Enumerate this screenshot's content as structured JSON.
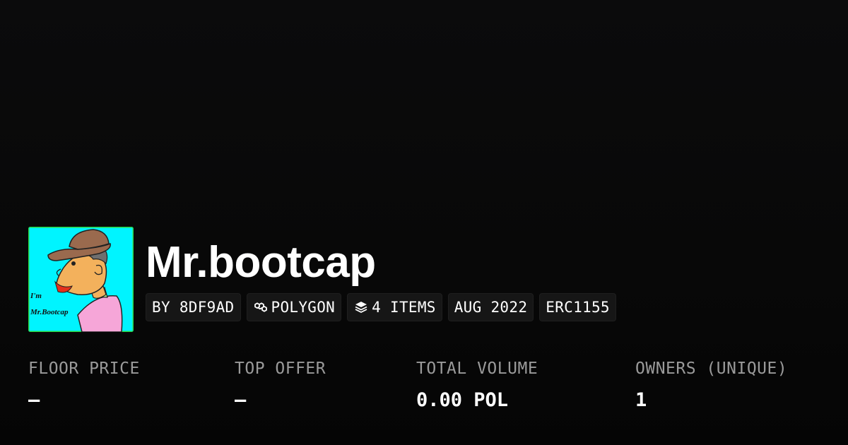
{
  "collection": {
    "name": "Mr.bootcap",
    "avatar": {
      "icon": "collection-avatar",
      "label_line1": "I'm",
      "label_line2": "Mr.Bootcap",
      "colors": {
        "background": "#00f4ff",
        "border": "#2bd63f",
        "hat": "#9a6a4e",
        "shirt": "#f6a6d8",
        "skin": "#f3b15c",
        "lips": "#e4301c"
      }
    }
  },
  "tags": [
    {
      "label": "BY 8DF9AD",
      "icon": ""
    },
    {
      "label": "POLYGON",
      "icon": "polygon-chain-icon"
    },
    {
      "label": "4 ITEMS",
      "icon": "layers-icon"
    },
    {
      "label": "AUG 2022",
      "icon": ""
    },
    {
      "label": "ERC1155",
      "icon": ""
    }
  ],
  "stats": [
    {
      "label": "FLOOR PRICE",
      "value": "–"
    },
    {
      "label": "TOP OFFER",
      "value": "–"
    },
    {
      "label": "TOTAL VOLUME",
      "value": "0.00 POL"
    },
    {
      "label": "OWNERS (UNIQUE)",
      "value": "1"
    }
  ],
  "colors": {
    "background": "#090909",
    "tag_background": "#161616",
    "label_gray": "#9a9a9a",
    "text": "#ffffff"
  }
}
